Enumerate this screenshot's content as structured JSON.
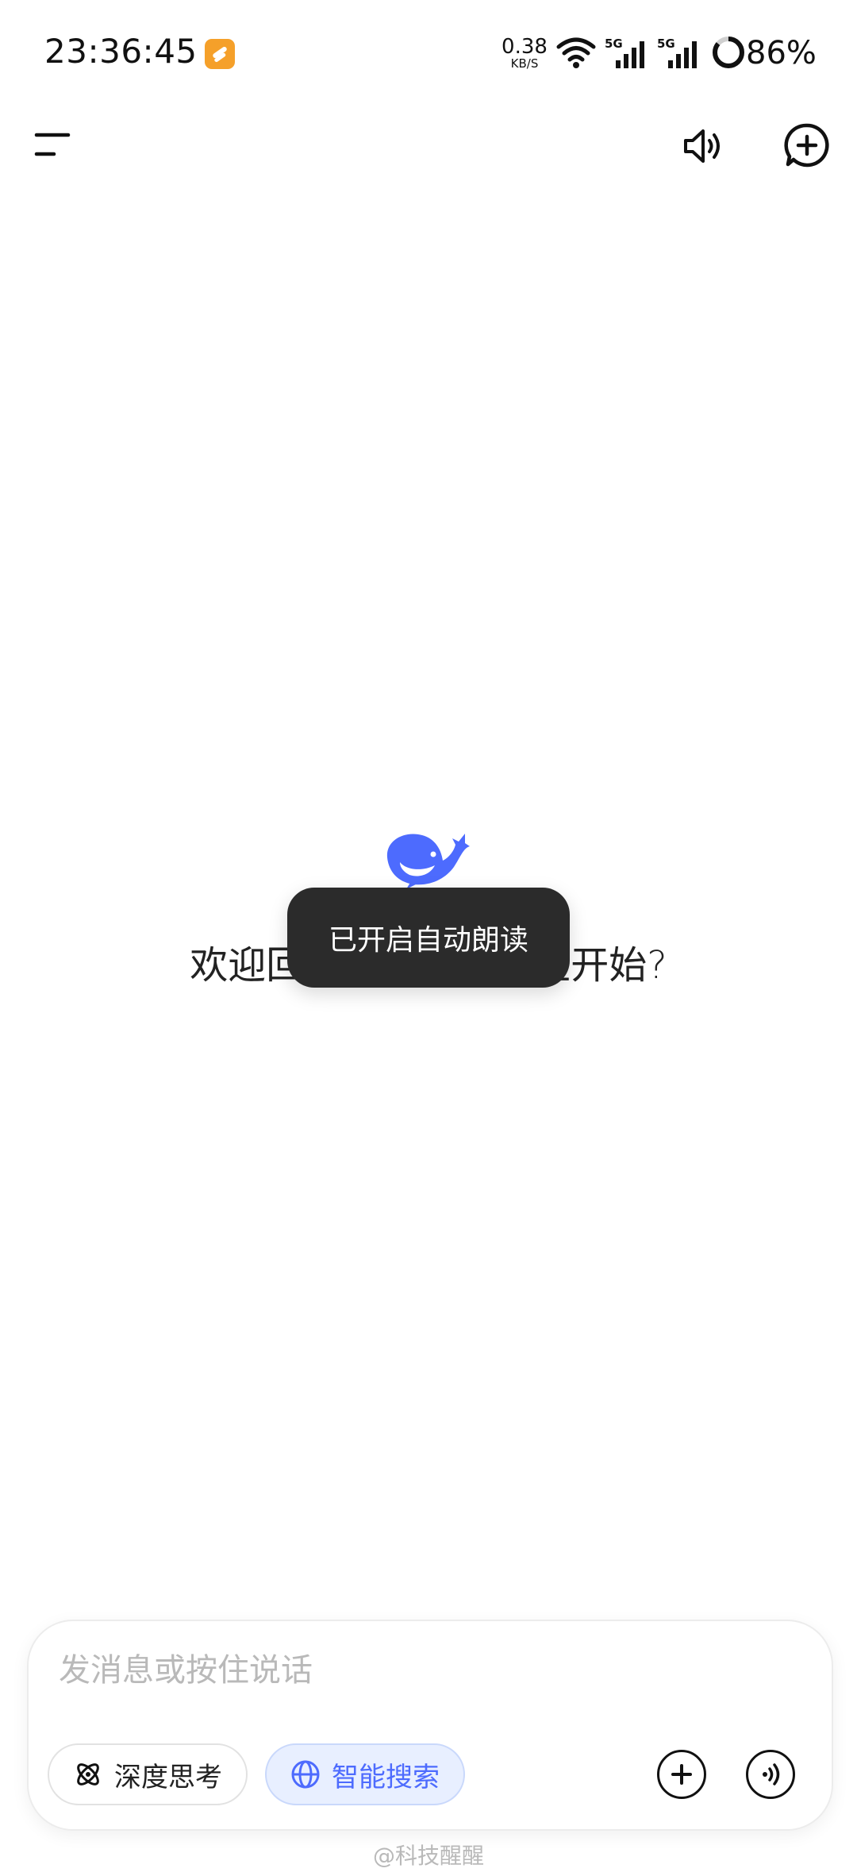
{
  "status_bar": {
    "time": "23:36:45",
    "net_speed_value": "0.38",
    "net_speed_unit": "KB/S",
    "signal_1_label": "5G",
    "signal_2_label": "5G",
    "battery": "86%",
    "battery_level": 0.86
  },
  "header": {
    "menu_icon": "menu-icon",
    "speaker_icon": "speaker-icon",
    "new_chat_icon": "new-chat-icon"
  },
  "main": {
    "welcome_text": "欢迎回来，今天从哪里开始?",
    "logo_icon": "whale-logo",
    "brand_color": "#4d6bfe"
  },
  "toast": {
    "text": "已开启自动朗读"
  },
  "composer": {
    "placeholder": "发消息或按住说话",
    "value": "",
    "deep_think_label": "深度思考",
    "smart_search_label": "智能搜索",
    "smart_search_active": true,
    "attach_icon": "plus-circle-icon",
    "voice_icon": "voice-call-icon"
  },
  "watermark": {
    "text": "@科技醒醒"
  }
}
